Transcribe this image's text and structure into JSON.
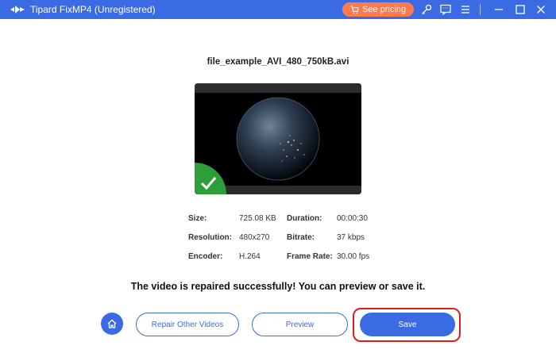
{
  "window": {
    "title": "Tipard FixMP4 (Unregistered)",
    "pricing_label": "See pricing",
    "icons": [
      "logo-icon",
      "cart-icon",
      "key-icon",
      "feedback-icon",
      "menu-icon",
      "minimize-icon",
      "maximize-icon",
      "close-icon"
    ]
  },
  "file": {
    "name": "file_example_AVI_480_750kB.avi"
  },
  "info": {
    "size_label": "Size:",
    "size_value": "725.08 KB",
    "duration_label": "Duration:",
    "duration_value": "00:00:30",
    "resolution_label": "Resolution:",
    "resolution_value": "480x270",
    "bitrate_label": "Bitrate:",
    "bitrate_value": "37 kbps",
    "encoder_label": "Encoder:",
    "encoder_value": "H.264",
    "framerate_label": "Frame Rate:",
    "framerate_value": "30.00 fps"
  },
  "message": "The video is repaired successfully! You can preview or save it.",
  "actions": {
    "repair_other_label": "Repair Other Videos",
    "preview_label": "Preview",
    "save_label": "Save"
  },
  "colors": {
    "accent": "#3b6be3",
    "pricing": "#ff7a4d",
    "success": "#2e9e3a",
    "highlight": "#e01b1b"
  }
}
